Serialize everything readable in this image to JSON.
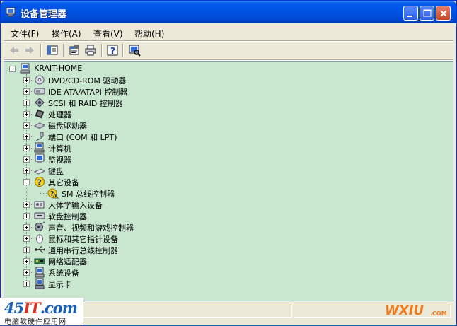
{
  "window": {
    "title": "设备管理器"
  },
  "menu": [
    {
      "label": "文件(F)"
    },
    {
      "label": "操作(A)"
    },
    {
      "label": "查看(V)"
    },
    {
      "label": "帮助(H)"
    }
  ],
  "toolbar": {
    "icons": [
      "back-arrow-icon",
      "forward-arrow-icon",
      "show-hide-console-tree-icon",
      "properties-icon",
      "print-icon",
      "help-icon",
      "scan-hardware-icon"
    ]
  },
  "tree": {
    "root": "KRAIT-HOME",
    "items": [
      {
        "label": "DVD/CD-ROM 驱动器",
        "icon": "cdrom-icon"
      },
      {
        "label": "IDE ATA/ATAPI 控制器",
        "icon": "ide-controller-icon"
      },
      {
        "label": "SCSI 和 RAID 控制器",
        "icon": "scsi-controller-icon"
      },
      {
        "label": "处理器",
        "icon": "processor-icon"
      },
      {
        "label": "磁盘驱动器",
        "icon": "disk-drive-icon"
      },
      {
        "label": "端口 (COM 和 LPT)",
        "icon": "port-icon"
      },
      {
        "label": "计算机",
        "icon": "computer-icon"
      },
      {
        "label": "监视器",
        "icon": "monitor-icon"
      },
      {
        "label": "键盘",
        "icon": "keyboard-icon"
      },
      {
        "label": "其它设备",
        "icon": "unknown-device-icon",
        "expanded": true,
        "children": [
          {
            "label": "SM 总线控制器",
            "icon": "unknown-device-warning-icon"
          }
        ]
      },
      {
        "label": "人体学输入设备",
        "icon": "hid-icon"
      },
      {
        "label": "软盘控制器",
        "icon": "floppy-controller-icon"
      },
      {
        "label": "声音、视频和游戏控制器",
        "icon": "sound-icon"
      },
      {
        "label": "鼠标和其它指针设备",
        "icon": "mouse-icon"
      },
      {
        "label": "通用串行总线控制器",
        "icon": "usb-icon"
      },
      {
        "label": "网络适配器",
        "icon": "network-adapter-icon"
      },
      {
        "label": "系统设备",
        "icon": "system-device-icon"
      },
      {
        "label": "显示卡",
        "icon": "display-adapter-icon"
      }
    ]
  },
  "watermarks": {
    "left_brand_a": "45",
    "left_brand_b": "IT",
    "left_brand_c": ".com",
    "left_sub": "电脑软硬件应用网",
    "right_brand": "WXIU",
    "right_sub": ".COM"
  },
  "colors": {
    "tree_background": "#c9e6cf",
    "titlebar": "#0054e3"
  }
}
